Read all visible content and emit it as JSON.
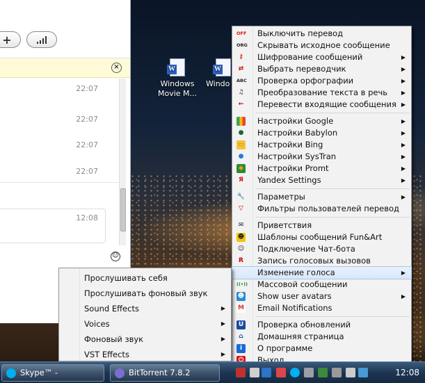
{
  "desktop": {
    "icons": [
      {
        "label_line1": "Windows",
        "label_line2": "Movie M..."
      },
      {
        "label_line1": "Windo",
        "label_line2": ""
      }
    ]
  },
  "skype": {
    "messages": [
      {
        "time": "22:07"
      },
      {
        "time": "22:07"
      },
      {
        "time": "22:07"
      },
      {
        "time": "22:07"
      },
      {
        "time": "12:08"
      }
    ]
  },
  "main_menu": {
    "items": [
      {
        "icon": "off-icon",
        "label": "Выключить перевод",
        "submenu": false
      },
      {
        "icon": "orig-icon",
        "label": "Скрывать исходное сообщение",
        "submenu": false
      },
      {
        "icon": "key-icon",
        "label": "Шифрование сообщений",
        "submenu": true
      },
      {
        "icon": "swap-arrows-icon",
        "label": "Выбрать переводчик",
        "submenu": true
      },
      {
        "icon": "abc-spellcheck-icon",
        "label": "Проверка орфографии",
        "submenu": true
      },
      {
        "icon": "music-note-icon",
        "label": "Преобразование текста в речь",
        "submenu": true
      },
      {
        "icon": "arrow-left-icon",
        "label": "Перевести входящие сообщения",
        "submenu": true
      },
      {
        "sep": true
      },
      {
        "icon": "google-icon",
        "label": "Настройки Google",
        "submenu": true
      },
      {
        "icon": "babylon-icon",
        "label": "Настройки Babylon",
        "submenu": true
      },
      {
        "icon": "bing-icon",
        "label": "Настройки Bing",
        "submenu": true
      },
      {
        "icon": "systran-icon",
        "label": "Настройки SysTran",
        "submenu": true
      },
      {
        "icon": "promt-icon",
        "label": "Настройки Promt",
        "submenu": true
      },
      {
        "icon": "yandex-icon",
        "label": "Yandex Settings",
        "submenu": true
      },
      {
        "sep": true
      },
      {
        "icon": "wrench-icon",
        "label": "Параметры",
        "submenu": true
      },
      {
        "icon": "filter-icon",
        "label": "Фильтры пользователей перевод",
        "submenu": false
      },
      {
        "sep": true
      },
      {
        "icon": "envelope-icon",
        "label": "Приветствия",
        "submenu": false
      },
      {
        "icon": "smiley-icon",
        "label": "Шаблоны сообщений Fun&Art",
        "submenu": false
      },
      {
        "icon": "bot-icon",
        "label": "Подключение Чат-бота",
        "submenu": false
      },
      {
        "icon": "record-icon",
        "label": "Запись голосовых вызовов",
        "submenu": false
      },
      {
        "icon": "",
        "label": "Изменение голоса",
        "submenu": true,
        "highlighted": true
      },
      {
        "icon": "broadcast-icon",
        "label": "Массовой сообщении",
        "submenu": false
      },
      {
        "icon": "avatar-icon",
        "label": "Show user avatars",
        "submenu": true
      },
      {
        "icon": "gmail-icon",
        "label": "Email Notifications",
        "submenu": false
      },
      {
        "sep": true
      },
      {
        "icon": "update-icon",
        "label": "Проверка обновлений",
        "submenu": false
      },
      {
        "icon": "home-icon",
        "label": "Домашняя страница",
        "submenu": false
      },
      {
        "icon": "info-icon",
        "label": "О программе",
        "submenu": false
      },
      {
        "icon": "exit-icon",
        "label": "Выход",
        "submenu": false
      }
    ]
  },
  "voice_submenu": {
    "items": [
      {
        "label": "Прослушивать себя",
        "submenu": false
      },
      {
        "label": "Прослушивать фоновый звук",
        "submenu": false
      },
      {
        "label": "Sound Effects",
        "submenu": true
      },
      {
        "label": "Voices",
        "submenu": true
      },
      {
        "label": "Фоновый звук",
        "submenu": true
      },
      {
        "label": "VST Effects",
        "submenu": true
      }
    ]
  },
  "taskbar": {
    "buttons": [
      {
        "label": "Skype™ - ",
        "icon": "skype-icon",
        "color": "#00aff0"
      },
      {
        "label": "BitTorrent 7.8.2",
        "icon": "bittorrent-icon",
        "color": "#7a6fd0"
      }
    ],
    "clock": "12:08"
  }
}
